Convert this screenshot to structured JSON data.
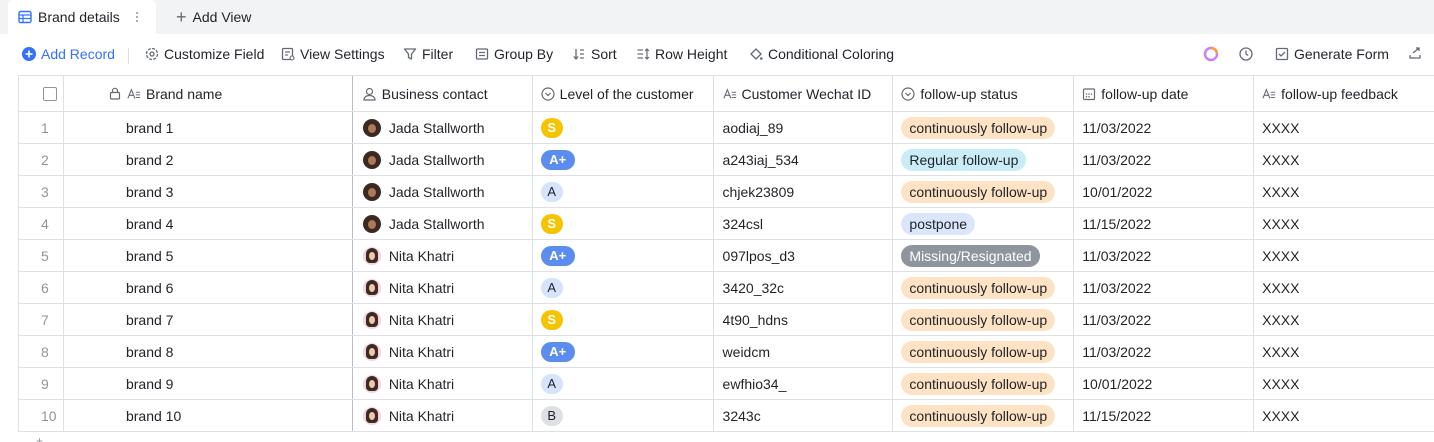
{
  "tabs": {
    "active_label": "Brand details",
    "add_view_label": "Add View"
  },
  "toolbar": {
    "add_record": "Add Record",
    "customize_field": "Customize Field",
    "view_settings": "View Settings",
    "filter": "Filter",
    "group_by": "Group By",
    "sort": "Sort",
    "row_height": "Row Height",
    "conditional_coloring": "Conditional Coloring",
    "generate_form": "Generate Form"
  },
  "columns": {
    "brand_name": "Brand name",
    "business_contact": "Business contact",
    "level": "Level of the customer",
    "wechat": "Customer Wechat ID",
    "status": "follow-up status",
    "date": "follow-up date",
    "feedback": "follow-up feedback"
  },
  "rows": [
    {
      "idx": "1",
      "name": "brand 1",
      "contact": "Jada Stallworth",
      "avatar": "dark",
      "level": "S",
      "wechat": "aodiaj_89",
      "status": "continuously follow-up",
      "status_type": "cont",
      "date": "11/03/2022",
      "feedback": "XXXX"
    },
    {
      "idx": "2",
      "name": "brand 2",
      "contact": "Jada Stallworth",
      "avatar": "dark",
      "level": "A+",
      "wechat": "a243iaj_534",
      "status": "Regular follow-up",
      "status_type": "reg",
      "date": "11/03/2022",
      "feedback": "XXXX"
    },
    {
      "idx": "3",
      "name": "brand 3",
      "contact": "Jada Stallworth",
      "avatar": "dark",
      "level": "A",
      "wechat": "chjek23809",
      "status": "continuously follow-up",
      "status_type": "cont",
      "date": "10/01/2022",
      "feedback": "XXXX"
    },
    {
      "idx": "4",
      "name": "brand 4",
      "contact": "Jada Stallworth",
      "avatar": "dark",
      "level": "S",
      "wechat": "324csl",
      "status": "postpone",
      "status_type": "post",
      "date": "11/15/2022",
      "feedback": "XXXX"
    },
    {
      "idx": "5",
      "name": "brand 5",
      "contact": "Nita Khatri",
      "avatar": "light",
      "level": "A+",
      "wechat": "097lpos_d3",
      "status": "Missing/Resignated",
      "status_type": "miss",
      "date": "11/03/2022",
      "feedback": "XXXX"
    },
    {
      "idx": "6",
      "name": "brand 6",
      "contact": "Nita Khatri",
      "avatar": "light",
      "level": "A",
      "wechat": "3420_32c",
      "status": "continuously follow-up",
      "status_type": "cont",
      "date": "11/03/2022",
      "feedback": "XXXX"
    },
    {
      "idx": "7",
      "name": "brand 7",
      "contact": "Nita Khatri",
      "avatar": "light",
      "level": "S",
      "wechat": "4t90_hdns",
      "status": "continuously follow-up",
      "status_type": "cont",
      "date": "11/03/2022",
      "feedback": "XXXX"
    },
    {
      "idx": "8",
      "name": "brand 8",
      "contact": "Nita Khatri",
      "avatar": "light",
      "level": "A+",
      "wechat": "weidcm",
      "status": "continuously follow-up",
      "status_type": "cont",
      "date": "11/03/2022",
      "feedback": "XXXX"
    },
    {
      "idx": "9",
      "name": "brand 9",
      "contact": "Nita Khatri",
      "avatar": "light",
      "level": "A",
      "wechat": "ewfhio34_",
      "status": "continuously follow-up",
      "status_type": "cont",
      "date": "10/01/2022",
      "feedback": "XXXX"
    },
    {
      "idx": "10",
      "name": "brand 10",
      "contact": "Nita Khatri",
      "avatar": "light",
      "level": "B",
      "wechat": "3243c",
      "status": "continuously follow-up",
      "status_type": "cont",
      "date": "11/15/2022",
      "feedback": "XXXX"
    }
  ],
  "colors": {
    "accent": "#3370ff",
    "level_S": "#f5c400",
    "level_Aplus": "#5b8def",
    "level_A": "#d6e3fb",
    "level_B": "#dee0e3",
    "status_cont": "#fde2c4",
    "status_reg": "#c9ecf7",
    "status_post": "#dbe6fc",
    "status_miss": "#8f959e"
  }
}
